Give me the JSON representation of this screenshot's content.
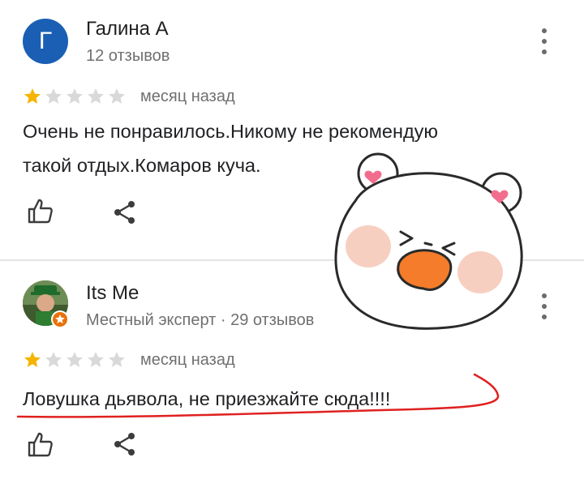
{
  "reviews": [
    {
      "avatar_letter": "Г",
      "author": "Галина А",
      "meta": "12 отзывов",
      "rating": 1,
      "max_rating": 5,
      "time": "месяц назад",
      "text_lines": [
        "Очень не понравилось.Никому не рекомендую",
        "такой отдых.Комаров куча."
      ]
    },
    {
      "avatar_letter": "",
      "author": "Its Me",
      "meta": "Местный эксперт · 29 отзывов",
      "rating": 1,
      "max_rating": 5,
      "time": "месяц назад",
      "text_lines": [
        "Ловушка дьявола, не приезжайте сюда!!!!"
      ]
    }
  ],
  "icons": {
    "like": "thumbs-up-icon",
    "share": "share-icon",
    "menu": "more-vert-icon",
    "badge": "local-guide-badge-icon"
  },
  "colors": {
    "star_filled": "#f5b400",
    "star_empty": "#d9d9d9",
    "avatar_bg": "#1a5fb4",
    "annotation": "#e02020",
    "sticker_blush": "#f7cfc1",
    "sticker_beak": "#f47c2a",
    "sticker_heart": "#f26d8d"
  }
}
